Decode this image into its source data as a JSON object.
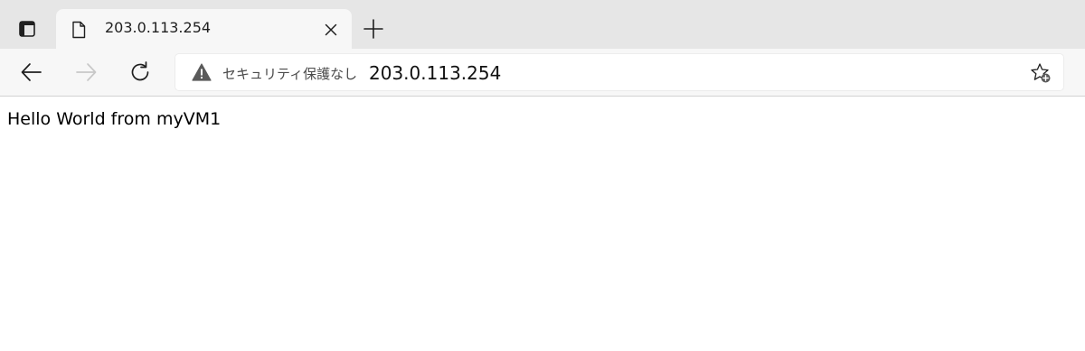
{
  "tab": {
    "title": "203.0.113.254"
  },
  "toolbar": {
    "back_icon": "arrow-left-icon",
    "forward_icon": "arrow-right-icon",
    "refresh_icon": "refresh-icon"
  },
  "addressbar": {
    "security_label": "セキュリティ保護なし",
    "url": "203.0.113.254",
    "favorite_icon": "add-favorite-icon"
  },
  "page": {
    "text": "Hello World from myVM1"
  },
  "colors": {
    "tabbar_bg": "#e6e6e6",
    "toolbar_bg": "#f7f7f7",
    "warning_icon": "#5a5a5a",
    "forward_disabled": "#c8c8c8"
  }
}
